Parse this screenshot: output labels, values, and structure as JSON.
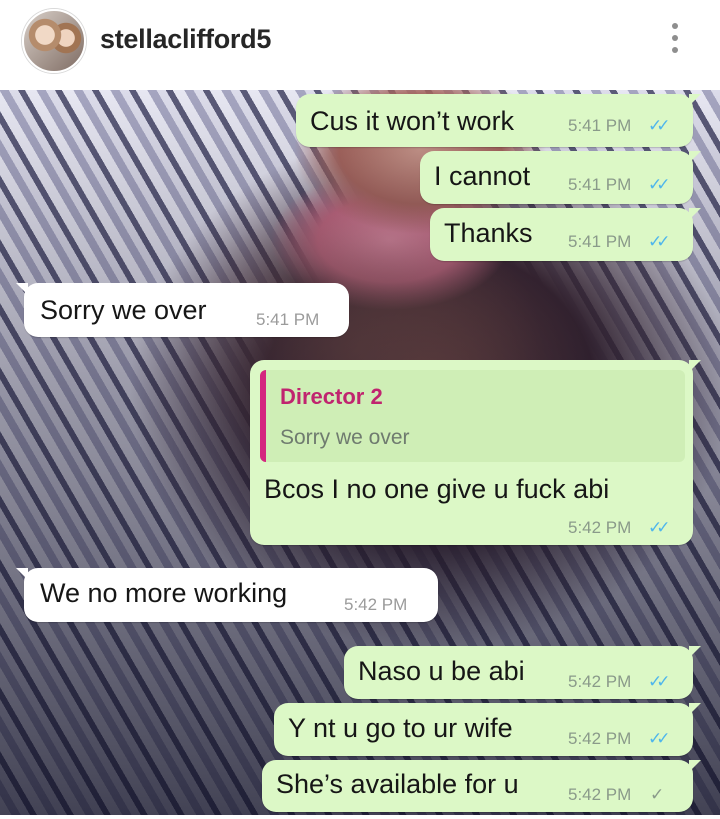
{
  "header": {
    "username": "stellaclifford5",
    "avatar_icon": "profile-avatar",
    "more_icon": "vertical-ellipsis-icon"
  },
  "colors": {
    "outgoing_bubble": "#dcf8c6",
    "incoming_bubble": "#ffffff",
    "read_ticks": "#4fb6ec",
    "quote_accent": "#d4267f"
  },
  "messages": [
    {
      "direction": "out",
      "text": "Cus it won’t work",
      "time": "5:41 PM",
      "status": "read"
    },
    {
      "direction": "out",
      "text": "I cannot",
      "time": "5:41 PM",
      "status": "read"
    },
    {
      "direction": "out",
      "text": "Thanks",
      "time": "5:41 PM",
      "status": "read"
    },
    {
      "direction": "in",
      "text": "Sorry we over",
      "time": "5:41 PM"
    },
    {
      "direction": "out",
      "quote": {
        "name": "Director 2",
        "text": "Sorry we over"
      },
      "text": "Bcos I no one give u fuck abi",
      "time": "5:42 PM",
      "status": "read"
    },
    {
      "direction": "in",
      "text": "We no more working",
      "time": "5:42 PM"
    },
    {
      "direction": "out",
      "text": "Naso u be abi",
      "time": "5:42 PM",
      "status": "read"
    },
    {
      "direction": "out",
      "text": "Y nt u go to ur wife",
      "time": "5:42 PM",
      "status": "read"
    },
    {
      "direction": "out",
      "text": "She’s available for u",
      "time": "5:42 PM",
      "status": "sent"
    }
  ],
  "ticks": {
    "read": "✓✓",
    "sent": "✓"
  }
}
